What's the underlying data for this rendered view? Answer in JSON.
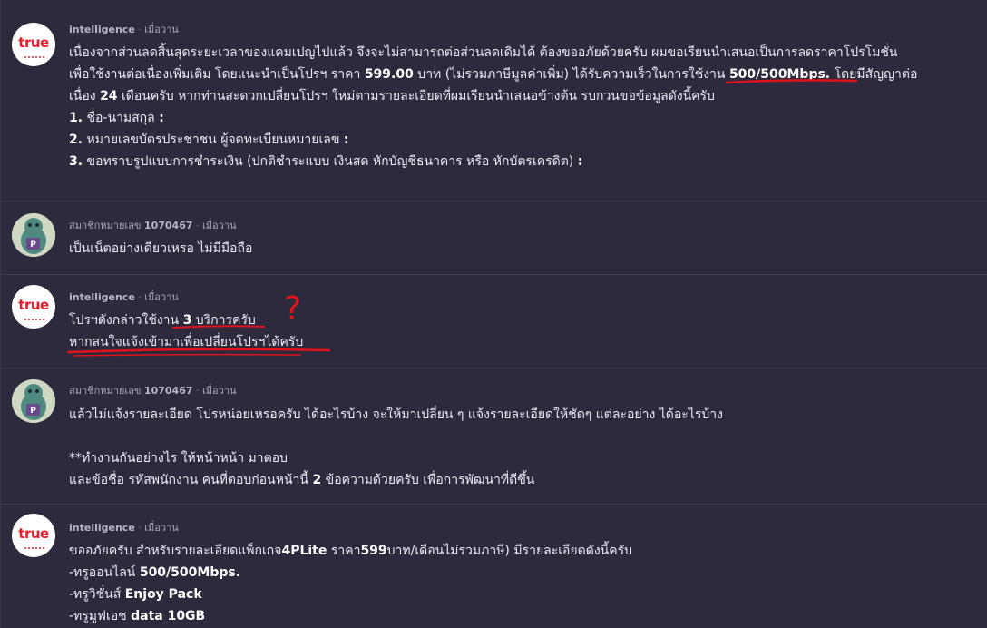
{
  "colors": {
    "background": "#2d2a3e",
    "annotation": "#e0131a",
    "true_brand": "#e5202e"
  },
  "annotation_glyph": "?",
  "posts": [
    {
      "author": "intelligence",
      "time": "เมื่อวาน",
      "avatar": "true-logo",
      "avatar_text": "true",
      "lines": [
        [
          "เนื่องจากส่วนลดสิ้นสุดระยะเวลาของแคมเปญไปแล้ว จึงจะไม่สามารถต่อส่วนลดเดิมได้ ต้องขออภัยด้วยครับ ผมขอเรียนนำเสนอเป็นการลดราคาโปรโมชั่น"
        ],
        [
          "เพื่อใช้งานต่อเนื่องเพิ่มเติม โดยแนะนำเป็นโปรฯ ราคา ",
          "599.00",
          " บาท (ไม่รวมภาษีมูลค่าเพิ่ม) ได้รับความเร็วในการใช้งาน ",
          "500/500Mbps.",
          " โดยมีสัญญาต่อ"
        ],
        [
          "เนื่อง ",
          "24",
          " เดือนครับ หากท่านสะดวกเปลี่ยนโปรฯ ใหม่ตามรายละเอียดที่ผมเรียนนำเสนอข้างต้น รบกวนขอข้อมูลดังนี้ครับ"
        ],
        [
          "1.",
          " ชื่อ-นามสกุล ",
          ":"
        ],
        [
          "2.",
          " หมายเลขบัตรประชาชน ผู้จดทะเบียนหมายเลข ",
          ":"
        ],
        [
          "3.",
          " ขอทราบรูปแบบการชำระเงิน (ปกติชำระแบบ เงินสด หักบัญชีธนาคาร หรือ หักบัตรเครดิต) ",
          ":"
        ]
      ]
    },
    {
      "author_prefix": "สมาชิกหมายเลข",
      "author_id": "1070467",
      "time": "เมื่อวาน",
      "avatar": "member-avatar",
      "lines": [
        [
          "เป็นเน็ตอย่างเดียวเหรอ ไม่มีมือถือ"
        ]
      ]
    },
    {
      "author": "intelligence",
      "time": "เมื่อวาน",
      "avatar": "true-logo",
      "avatar_text": "true",
      "lines": [
        [
          "โปรฯดังกล่าวใช้งาน ",
          "3",
          " บริการครับ"
        ],
        [
          "หากสนใจแจ้งเข้ามาเพื่อเปลี่ยนโปรฯได้ครับ"
        ]
      ]
    },
    {
      "author_prefix": "สมาชิกหมายเลข",
      "author_id": "1070467",
      "time": "เมื่อวาน",
      "avatar": "member-avatar",
      "lines": [
        [
          "แล้วไม่แจ้งรายละเอียด โปรหน่อยเหรอครับ ได้อะไรบ้าง จะให้มาเปลี่ยน ๆ  แจ้งรายละเอียดให้ชัดๆ  แต่ละอย่าง ได้อะไรบ้าง"
        ],
        [],
        [
          "**ทำงานกันอย่างไร ให้หน้าหน้า มาตอบ"
        ],
        [
          "และข้อชื่อ รหัสพนักงาน คนที่ตอบก่อนหน้านี้ ",
          "2",
          " ข้อความด้วยครับ  เพื่อการพัฒนาที่ดีขึ้น"
        ]
      ]
    },
    {
      "author": "intelligence",
      "time": "เมื่อวาน",
      "avatar": "true-logo",
      "avatar_text": "true",
      "lines": [
        [
          "ขออภัยครับ สำหรับรายละเอียดแพ็กเกจ",
          "4PLite",
          " ราคา",
          "599",
          "บาท/เดือนไม่รวมภาษี) มีรายละเอียดดังนี้ครับ"
        ],
        [
          "-ทรูออนไลน์ ",
          "500/500Mbps."
        ],
        [
          "-ทรูวิชั่นส์ ",
          "Enjoy Pack"
        ],
        [
          "-ทรูมูฟเอช ",
          "data 10GB"
        ]
      ]
    }
  ]
}
